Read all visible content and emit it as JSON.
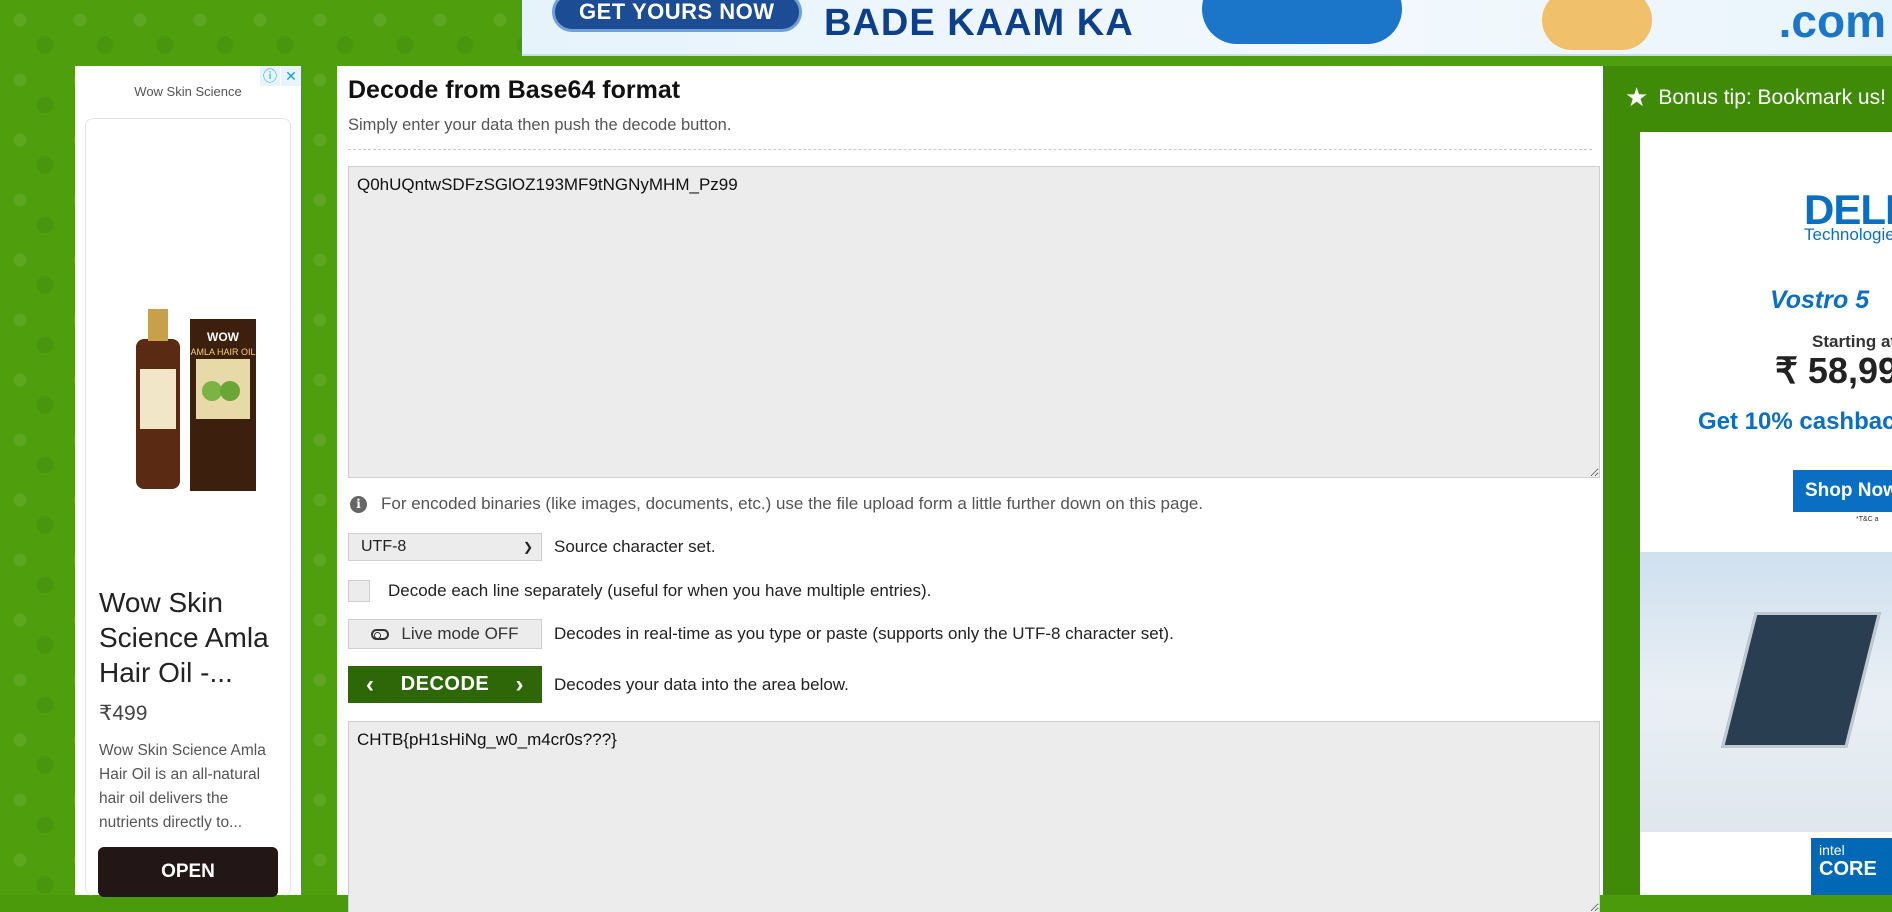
{
  "top_ad": {
    "cta_label": "GET YOURS NOW",
    "tagline": "BADE KAAM KA",
    "domain": ".com"
  },
  "left_ad": {
    "sponsor": "Wow Skin Science",
    "title": "Wow Skin Science Amla Hair Oil -...",
    "price": "₹499",
    "description": "Wow Skin Science Amla Hair Oil is an all-natural hair oil delivers the nutrients directly to...",
    "open_label": "OPEN",
    "product_brand": "WOW",
    "product_name": "AMLA HAIR OIL"
  },
  "main": {
    "title": "Decode from Base64 format",
    "subtitle": "Simply enter your data then push the decode button.",
    "input_value": "Q0hUQntwSDFzSGlOZ193MF9tNGNyMHM_Pz99",
    "info_text": "For encoded binaries (like images, documents, etc.) use the file upload form a little further down on this page.",
    "charset_value": "UTF-8",
    "charset_label": "Source character set.",
    "line_by_line_label": "Decode each line separately (useful for when you have multiple entries).",
    "live_mode_label": "Live mode OFF",
    "live_mode_desc": "Decodes in real-time as you type or paste (supports only the UTF-8 character set).",
    "decode_label": "DECODE",
    "decode_desc": "Decodes your data into the area below.",
    "output_value": "CHTB{pH1sHiNg_w0_m4cr0s???}"
  },
  "right_rail": {
    "bonus_tip": "Bonus tip: Bookmark us!",
    "dell_logo": "DELL",
    "dell_sub": "Technologies",
    "model": "Vostro 5",
    "starting_at": "Starting at",
    "price": "₹ 58,99",
    "cashback": "Get 10% cashbac",
    "shop_label": "Shop Now",
    "tsc": "*T&C a",
    "intel_label": "intel",
    "core_label": "CORE"
  },
  "colors": {
    "page_bg": "#4e9e0e",
    "decode_button": "#2e6707",
    "rail_bg": "#3f8a07"
  }
}
